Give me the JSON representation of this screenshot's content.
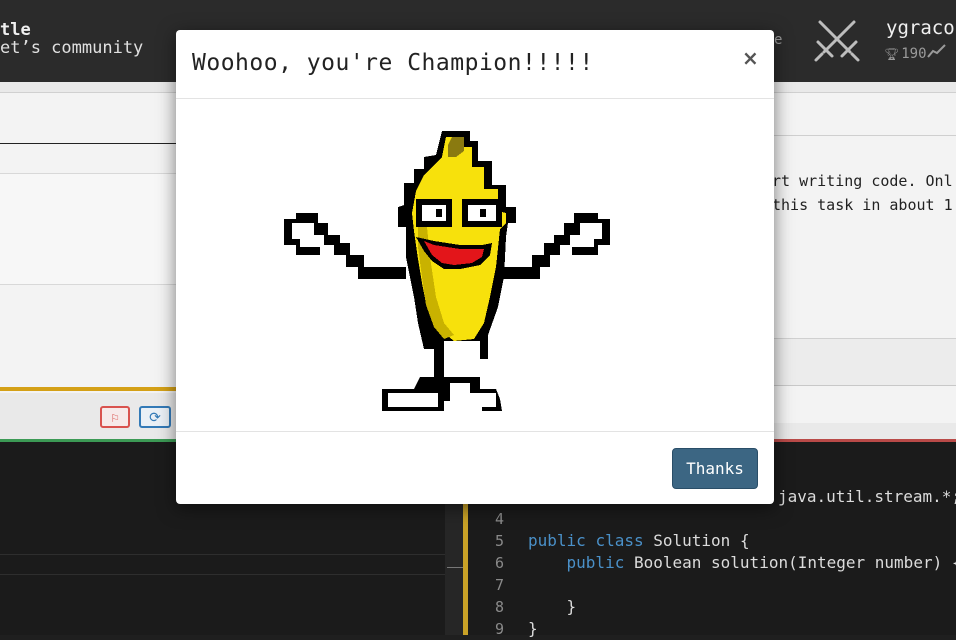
{
  "header": {
    "brand_title": "tle",
    "brand_subtitle": "et’s community",
    "nav_fragment": "e",
    "username": "ygraco",
    "score": "190"
  },
  "task": {
    "description": "rt writing code. Onl\nthis task in about 1"
  },
  "editor": {
    "line_numbers": [
      "4",
      "5",
      "6",
      "7",
      "8",
      "9"
    ],
    "code_line_3": "java.util.stream.*;",
    "code_line_5_kw1": "public",
    "code_line_5_kw2": "class",
    "code_line_5_rest": " Solution {",
    "code_line_6_kw": "public",
    "code_line_6_rest": " Boolean solution(Integer number) {",
    "code_line_8": "    }",
    "code_line_9": "}"
  },
  "modal": {
    "title": "Woohoo, you're Champion!!!!!",
    "close_label": "×",
    "button_label": "Thanks",
    "image": "dancing-banana"
  },
  "colors": {
    "modal_button": "#3c6683",
    "flag": "#d9534f",
    "refresh": "#337ab7",
    "keyword": "#4a90c8"
  },
  "icons": {
    "header": "crossed-swords-icon",
    "score": "trophy-icon",
    "flag_button": "flag-icon",
    "refresh_button": "refresh-icon"
  }
}
